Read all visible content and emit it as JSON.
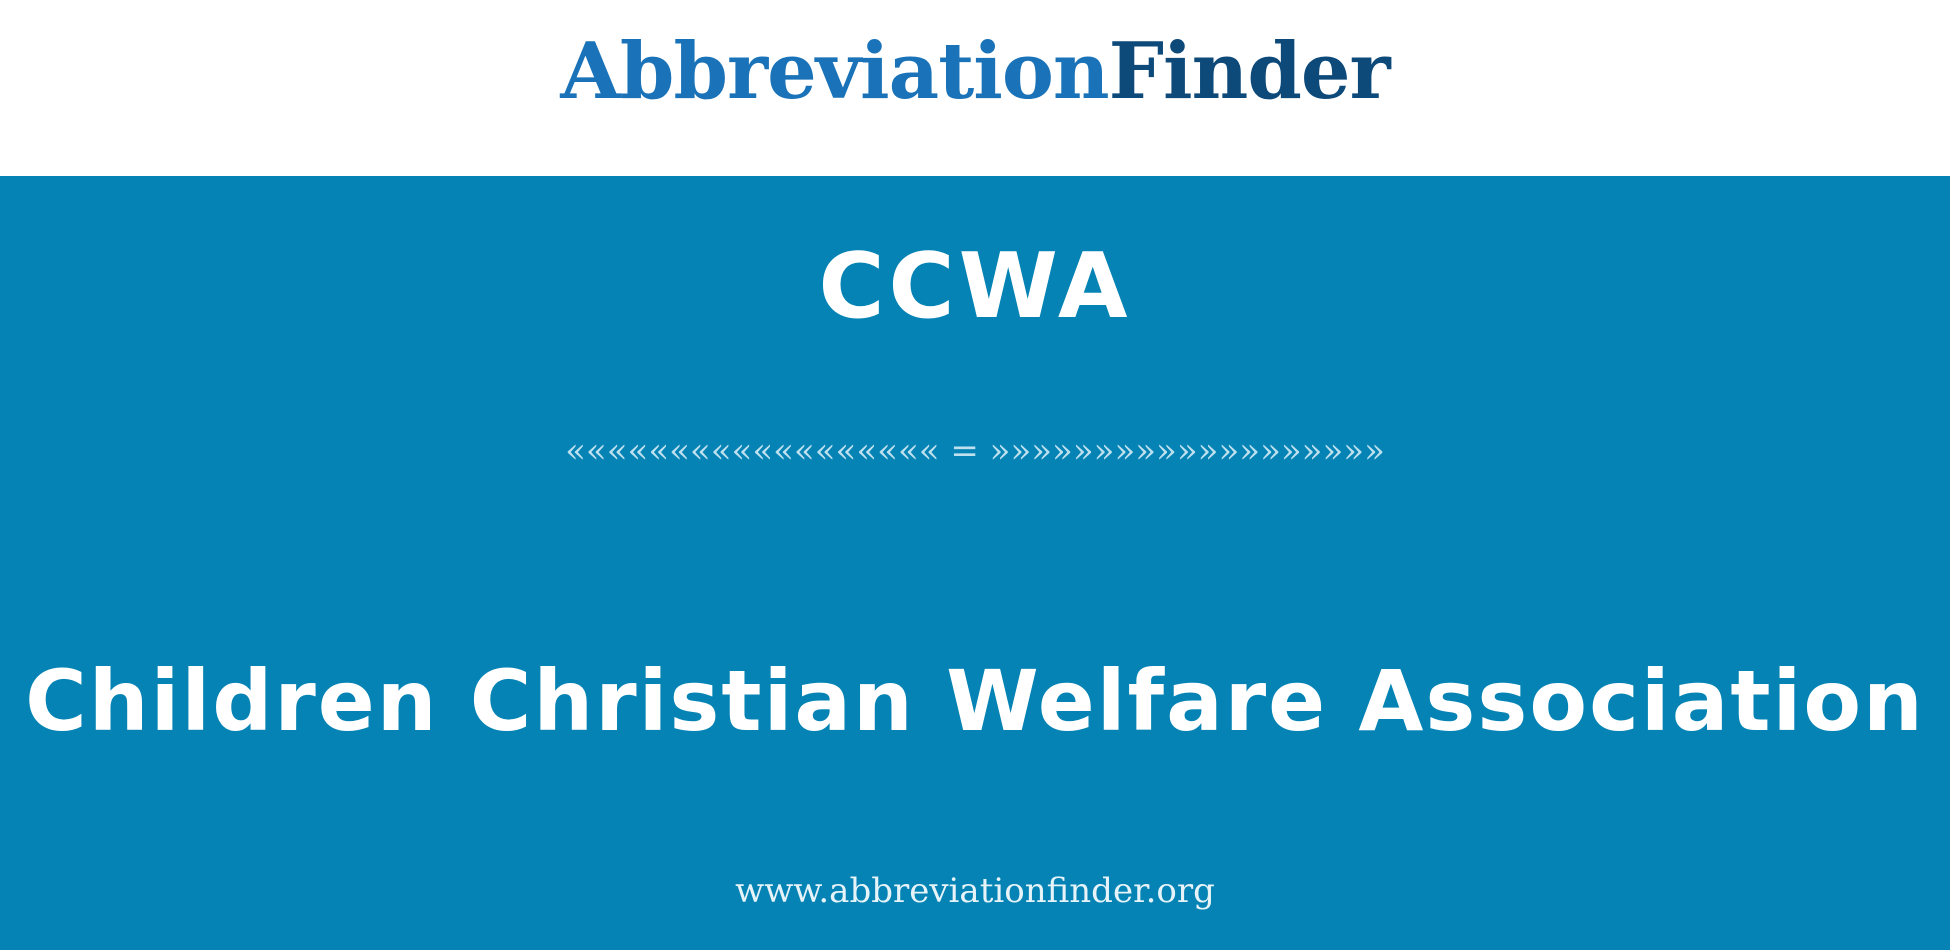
{
  "header": {
    "logo_part_1": "Abbreviation",
    "logo_part_2": "Finder"
  },
  "banner": {
    "abbreviation": "CCWA",
    "divider": "«««««««««««««««««« = »»»»»»»»»»»»»»»»»»»",
    "full_form": "Children Christian Welfare Association",
    "website": "www.abbreviationfinder.org"
  },
  "colors": {
    "banner_background": "#0483b4",
    "logo_primary": "#1a73b8",
    "logo_secondary": "#0d4a7a",
    "text": "#ffffff"
  }
}
